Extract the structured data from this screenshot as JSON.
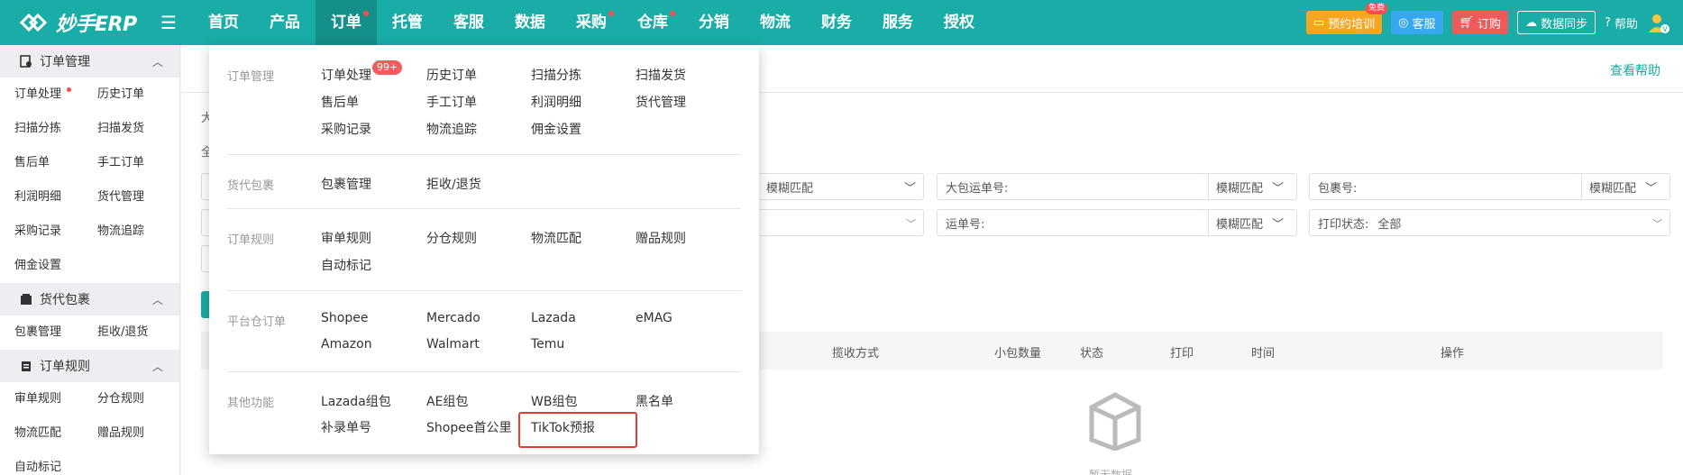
{
  "brand": {
    "name": "妙手ERP"
  },
  "nav": [
    {
      "label": "首页",
      "dot": false
    },
    {
      "label": "产品",
      "dot": false
    },
    {
      "label": "订单",
      "dot": true,
      "active": true
    },
    {
      "label": "托管",
      "dot": false
    },
    {
      "label": "客服",
      "dot": false
    },
    {
      "label": "数据",
      "dot": false
    },
    {
      "label": "采购",
      "dot": true
    },
    {
      "label": "仓库",
      "dot": true
    },
    {
      "label": "分销",
      "dot": false
    },
    {
      "label": "物流",
      "dot": false
    },
    {
      "label": "财务",
      "dot": false
    },
    {
      "label": "服务",
      "dot": false
    },
    {
      "label": "授权",
      "dot": false
    }
  ],
  "topright": {
    "training": "预约培训",
    "free_badge": "免费",
    "service": "客服",
    "order": "订购",
    "sync": "数据同步",
    "help": "帮助"
  },
  "sidebar": {
    "groups": [
      {
        "title": "订单管理",
        "icon": "order-manage-icon",
        "items": [
          "订单处理",
          "历史订单",
          "扫描分拣",
          "扫描发货",
          "售后单",
          "手工订单",
          "利润明细",
          "货代管理",
          "采购记录",
          "物流追踪",
          "佣金设置"
        ]
      },
      {
        "title": "货代包裹",
        "icon": "package-icon",
        "items": [
          "包裹管理",
          "拒收/退货"
        ]
      },
      {
        "title": "订单规则",
        "icon": "rules-icon",
        "items": [
          "审单规则",
          "分仓规则",
          "物流匹配",
          "赠品规则",
          "自动标记"
        ]
      }
    ]
  },
  "main": {
    "help_link": "查看帮助",
    "frag_1": "大",
    "frag_2": "全",
    "fuzzy": "模糊匹配",
    "big_package_label": "大包运单号:",
    "package_no_label": "包裹号:",
    "tracking_label": "运单号:",
    "print_status_label": "打印状态:",
    "print_status_value": "全部",
    "table_headers": [
      "揽收方式",
      "小包数量",
      "状态",
      "打印",
      "时间",
      "操作"
    ],
    "empty": "暂无数据"
  },
  "panel": {
    "badge": "99+",
    "sections": [
      {
        "title": "订单管理",
        "items": [
          "订单处理",
          "历史订单",
          "扫描分拣",
          "扫描发货",
          "售后单",
          "手工订单",
          "利润明细",
          "货代管理",
          "采购记录",
          "物流追踪",
          "佣金设置"
        ]
      },
      {
        "title": "货代包裹",
        "items": [
          "包裹管理",
          "拒收/退货"
        ]
      },
      {
        "title": "订单规则",
        "items": [
          "审单规则",
          "分仓规则",
          "物流匹配",
          "赠品规则",
          "自动标记"
        ]
      },
      {
        "title": "平台仓订单",
        "items": [
          "Shopee",
          "Mercado",
          "Lazada",
          "eMAG",
          "Amazon",
          "Walmart",
          "Temu"
        ]
      },
      {
        "title": "其他功能",
        "items": [
          "Lazada组包",
          "AE组包",
          "WB组包",
          "黑名单",
          "补录单号",
          "Shopee首公里",
          "TikTok预报"
        ]
      }
    ]
  },
  "colors": {
    "primary": "#1aaca6",
    "active_nav": "#158f8a",
    "highlight": "#e53935"
  }
}
